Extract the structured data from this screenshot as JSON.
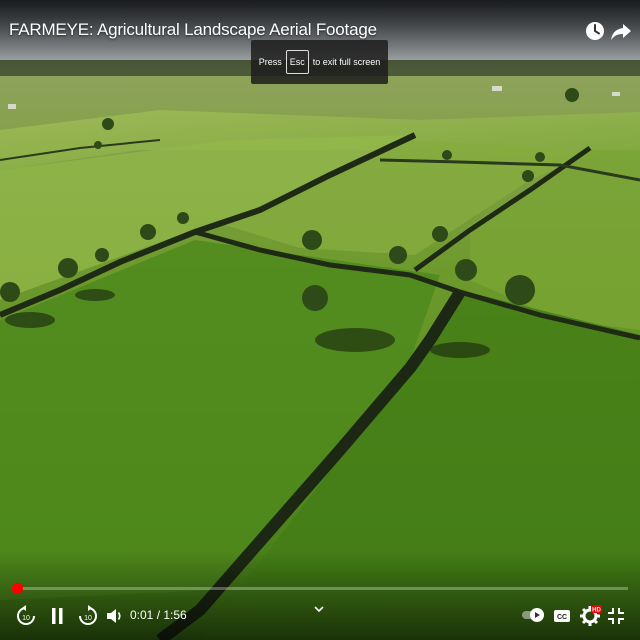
{
  "video": {
    "title": "FARMEYE: Agricultural Landscape Aerial Footage",
    "scene_description_icon": "aerial-farmland-video-frame"
  },
  "toast": {
    "prefix": "Press",
    "key": "Esc",
    "suffix": "to exit full screen"
  },
  "player": {
    "current_time": "0:01",
    "separator": " / ",
    "duration": "1:56",
    "time_display": "0:01 / 1:56",
    "progress_fraction": 0.0086,
    "accent_color": "#ff0000",
    "quality_badge": "HD"
  },
  "icons": {
    "watch_later": "clock-icon",
    "share": "share-arrow-icon",
    "seek_back": "replay-10-icon",
    "play_pause": "pause-icon",
    "seek_forward": "forward-10-icon",
    "volume": "volume-icon",
    "more": "chevron-down-icon",
    "autoplay": "autoplay-toggle-icon",
    "captions": "cc-icon",
    "settings": "gear-icon",
    "fullscreen": "exit-fullscreen-icon"
  }
}
